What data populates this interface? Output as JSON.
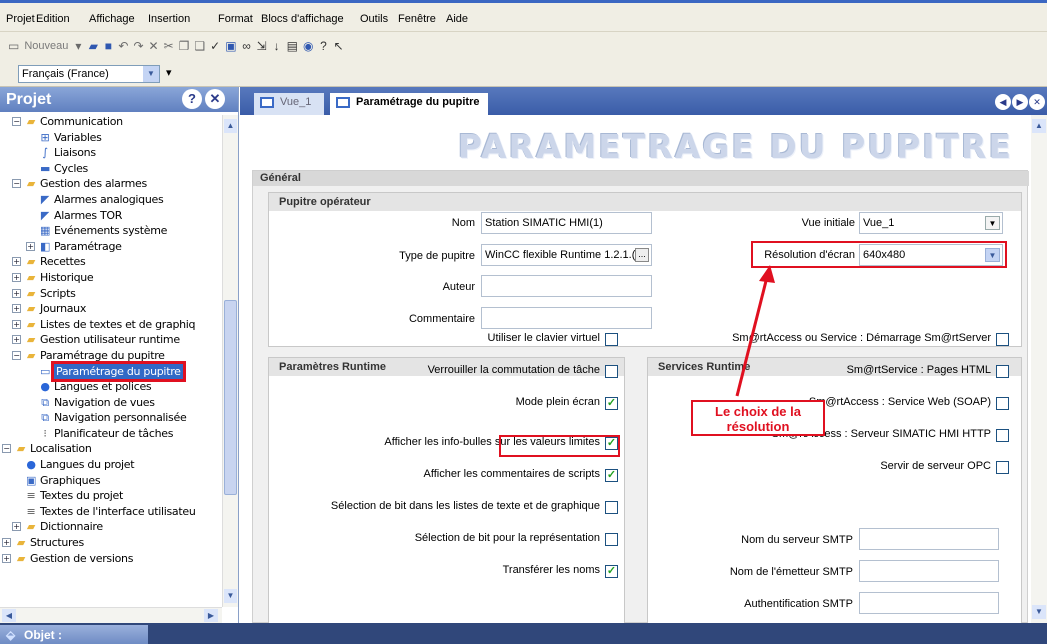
{
  "menu": [
    "Projet",
    "Edition",
    "Affichage",
    "Insertion",
    "Format",
    "Blocs d'affichage",
    "Outils",
    "Fenêtre",
    "Aide"
  ],
  "toolbar": {
    "new_label": "Nouveau"
  },
  "language": {
    "value": "Français (France)"
  },
  "project": {
    "title": "Projet",
    "tree": [
      {
        "label": "Communication",
        "icon": "folder-icon",
        "exp": "minus"
      },
      {
        "label": "Variables",
        "icon": "variables-icon"
      },
      {
        "label": "Liaisons",
        "icon": "connections-icon"
      },
      {
        "label": "Cycles",
        "icon": "cycles-icon"
      },
      {
        "label": "Gestion des alarmes",
        "icon": "folder-icon",
        "exp": "minus"
      },
      {
        "label": "Alarmes analogiques",
        "icon": "alarm-icon"
      },
      {
        "label": "Alarmes TOR",
        "icon": "alarm-icon"
      },
      {
        "label": "Evénements système",
        "icon": "system-events-icon"
      },
      {
        "label": "Paramétrage",
        "icon": "settings-icon",
        "exp": "plus"
      },
      {
        "label": "Recettes",
        "icon": "folder-icon",
        "exp": "plus"
      },
      {
        "label": "Historique",
        "icon": "folder-icon",
        "exp": "plus"
      },
      {
        "label": "Scripts",
        "icon": "folder-icon",
        "exp": "plus"
      },
      {
        "label": "Journaux",
        "icon": "folder-icon",
        "exp": "plus"
      },
      {
        "label": "Listes de textes et de graphiq",
        "icon": "folder-icon",
        "exp": "plus"
      },
      {
        "label": "Gestion utilisateur runtime",
        "icon": "folder-icon",
        "exp": "plus"
      },
      {
        "label": "Paramétrage du pupitre",
        "icon": "folder-icon",
        "exp": "minus"
      },
      {
        "label": "Paramétrage du pupitre",
        "icon": "panel-icon",
        "selected": true
      },
      {
        "label": "Langues et polices",
        "icon": "globe-icon"
      },
      {
        "label": "Navigation de vues",
        "icon": "navigation-icon"
      },
      {
        "label": "Navigation personnalisée",
        "icon": "navigation-icon"
      },
      {
        "label": "Planificateur de tâches",
        "icon": "scheduler-icon"
      },
      {
        "label": "Localisation",
        "icon": "folder-icon",
        "exp": "minus"
      },
      {
        "label": "Langues du projet",
        "icon": "globe-icon"
      },
      {
        "label": "Graphiques",
        "icon": "graphics-icon"
      },
      {
        "label": "Textes du projet",
        "icon": "document-icon"
      },
      {
        "label": "Textes de l'interface utilisateu",
        "icon": "document-icon"
      },
      {
        "label": "Dictionnaire",
        "icon": "folder-icon",
        "exp": "plus"
      },
      {
        "label": "Structures",
        "icon": "folder-icon",
        "exp": "plus"
      },
      {
        "label": "Gestion de versions",
        "icon": "folder-icon",
        "exp": "plus"
      }
    ]
  },
  "tabs": [
    {
      "label": "Vue_1"
    },
    {
      "label": "Paramétrage du pupitre"
    }
  ],
  "page": {
    "title": "PARAMETRAGE DU PUPITRE",
    "general": "Général"
  },
  "operator": {
    "title": "Pupitre opérateur",
    "name_label": "Nom",
    "name_value": "Station SIMATIC HMI(1)",
    "type_label": "Type de pupitre",
    "type_value": "WinCC flexible Runtime 1.2.1.(",
    "author_label": "Auteur",
    "author_value": "",
    "comment_label": "Commentaire",
    "comment_value": "",
    "initial_view_label": "Vue initiale",
    "initial_view_value": "Vue_1",
    "resolution_label": "Résolution d'écran",
    "resolution_value": "640x480"
  },
  "callout": {
    "line1": "Le choix de la",
    "line2": "résolution",
    "color": "#e01020"
  },
  "runtime": {
    "title": "Paramètres Runtime",
    "items": [
      {
        "label": "Utiliser le clavier virtuel",
        "checked": false
      },
      {
        "label": "Verrouiller la commutation de tâche",
        "checked": false
      },
      {
        "label": "Mode plein écran",
        "checked": true
      },
      {
        "label": "Afficher les info-bulles sur les valeurs limites",
        "checked": true
      },
      {
        "label": "Afficher les commentaires de scripts",
        "checked": true
      },
      {
        "label": "Sélection de bit dans les listes de texte et de graphique",
        "checked": false
      },
      {
        "label": "Sélection de bit pour la représentation",
        "checked": false
      },
      {
        "label": "Transférer les noms",
        "checked": true
      }
    ]
  },
  "services": {
    "title": "Services Runtime",
    "items": [
      {
        "label": "Sm@rtAccess ou Service : Démarrage Sm@rtServer",
        "checked": false
      },
      {
        "label": "Sm@rtService : Pages HTML",
        "checked": false
      },
      {
        "label": "Sm@rtAccess : Service Web (SOAP)",
        "checked": false
      },
      {
        "label": "Sm@rtAccess : Serveur SIMATIC HMI HTTP",
        "checked": false
      },
      {
        "label": "Servir de serveur OPC",
        "checked": false
      }
    ],
    "smtp_server_label": "Nom du serveur SMTP",
    "smtp_server_value": "",
    "smtp_sender_label": "Nom de l'émetteur SMTP",
    "smtp_sender_value": "",
    "smtp_auth_label": "Authentification SMTP",
    "smtp_auth_value": ""
  },
  "bottom": {
    "objet_label": "Objet :"
  }
}
